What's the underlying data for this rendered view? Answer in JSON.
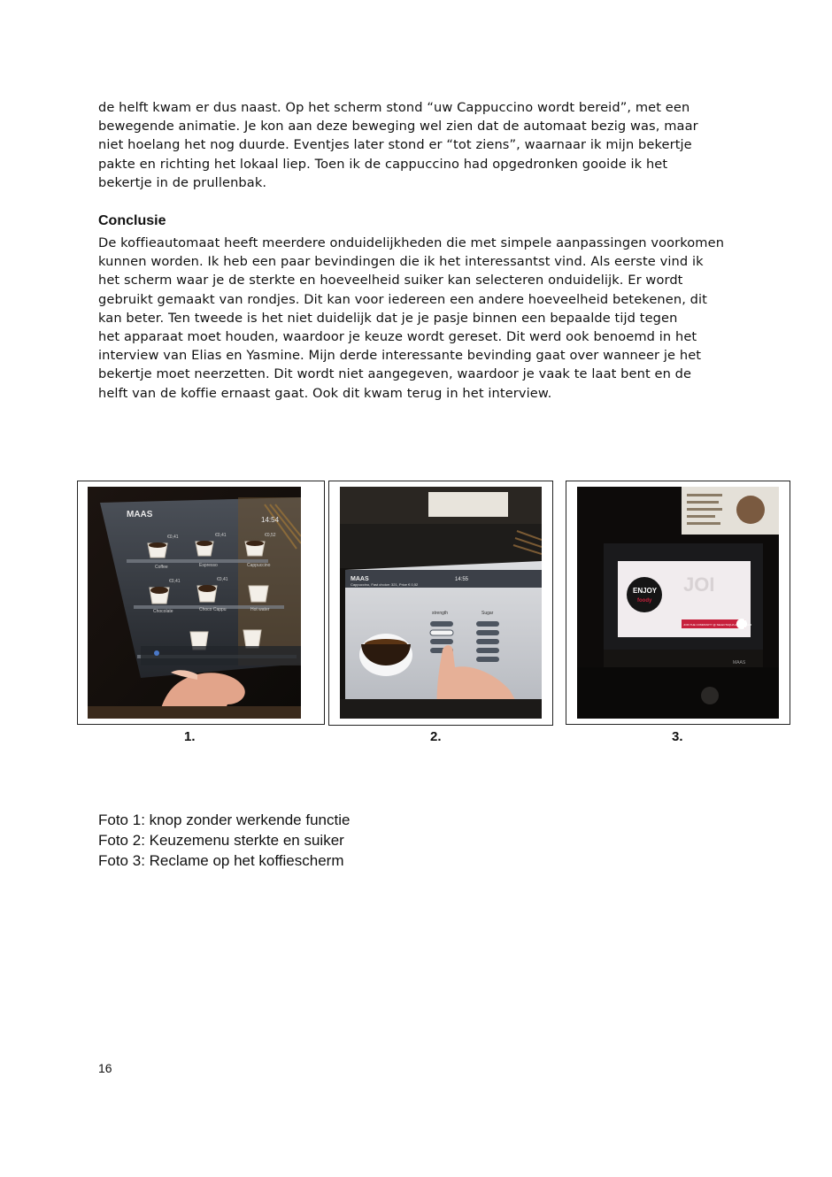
{
  "intro_lines": [
    "de helft kwam er dus naast. Op het scherm stond “uw Cappuccino wordt bereid”, met een",
    "bewegende animatie. Je kon aan deze beweging wel zien dat de automaat bezig was, maar",
    "niet hoelang het nog duurde. Eventjes later stond er “tot ziens”, waarnaar ik mijn bekertje",
    "pakte en richting het lokaal liep. Toen ik de cappuccino had opgedronken gooide ik het",
    "bekertje in de prullenbak."
  ],
  "conclusion_heading": "Conclusie",
  "conclusion_lines": [
    "De koffieautomaat heeft meerdere onduidelijkheden die met simpele aanpassingen voorkomen",
    "kunnen worden. Ik heb een paar bevindingen die ik het interessantst vind. Als eerste vind ik",
    "het scherm waar je de sterkte en hoeveelheid suiker kan selecteren onduidelijk. Er wordt",
    "gebruikt gemaakt van rondjes. Dit kan voor iedereen een andere hoeveelheid betekenen, dit",
    "kan beter. Ten tweede is het niet duidelijk dat je je pasje binnen een bepaalde tijd tegen",
    "het apparaat moet houden, waardoor je keuze wordt gereset. Dit werd ook benoemd in het",
    "interview van Elias en Yasmine. Mijn derde interessante bevinding gaat over wanneer je het",
    "bekertje moet neerzetten. Dit wordt niet aangegeven, waardoor je vaak te laat bent en de",
    "helft van de koffie ernaast gaat. Ook dit kwam terug in het interview."
  ],
  "photos": [
    {
      "number": "1.",
      "screen_brand": "MAAS",
      "screen_time": "14:54",
      "screen_prices": [
        "€0,41",
        "€0,41",
        "€0,52",
        "€0,41",
        "€0,41"
      ],
      "screen_items": [
        "Coffee",
        "Espresso",
        "Cappuccino",
        "Chocolate",
        "Choco Cappu",
        "Hot water"
      ]
    },
    {
      "number": "2.",
      "screen_brand": "MAAS",
      "screen_time": "14:55",
      "screen_subtitle": "Cappuccino, Fast choice: 321, Price € 0,52",
      "screen_col1": "strength",
      "screen_col2": "Sugar"
    },
    {
      "number": "3.",
      "screen_ad_top": "ENJOY",
      "screen_ad_brand": "foody",
      "screen_ad_text": "JOIN THE COMMUNITY @ SELECTAQUA AMSTERDAM",
      "machine_brand": "MAAS"
    }
  ],
  "captions": [
    "Foto 1: knop zonder werkende functie",
    "Foto 2: Keuzemenu sterkte en suiker",
    "Foto 3: Reclame op het koffiescherm"
  ],
  "page_number": "16"
}
